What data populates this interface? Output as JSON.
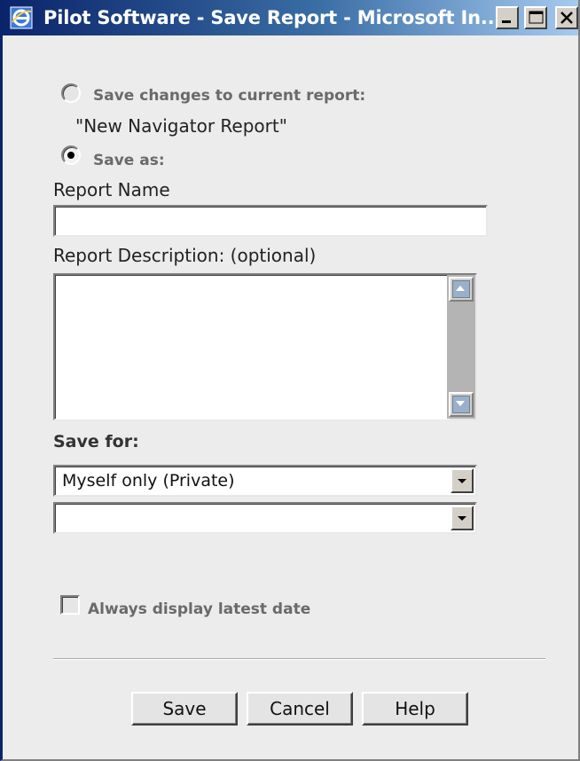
{
  "window": {
    "title": "Pilot Software - Save Report - Microsoft In...",
    "controls": [
      "minimize-icon",
      "maximize-icon",
      "close-icon"
    ]
  },
  "options": {
    "save_changes_label": "Save changes to current report:",
    "current_report_name": "\"New Navigator Report\"",
    "save_as_label": "Save as:",
    "selected": "save_as"
  },
  "form": {
    "report_name_label": "Report Name",
    "report_name_value": "",
    "report_description_label": "Report Description: (optional)",
    "report_description_value": "",
    "save_for_label": "Save for:",
    "save_for_selected": "Myself only (Private)",
    "secondary_selected": "",
    "always_latest_label": "Always display latest date",
    "always_latest_checked": false
  },
  "buttons": {
    "save": "Save",
    "cancel": "Cancel",
    "help": "Help"
  },
  "colors": {
    "titlebar_start": "#0a246a",
    "titlebar_end": "#a6caf0",
    "dialog_bg": "#ececec"
  }
}
